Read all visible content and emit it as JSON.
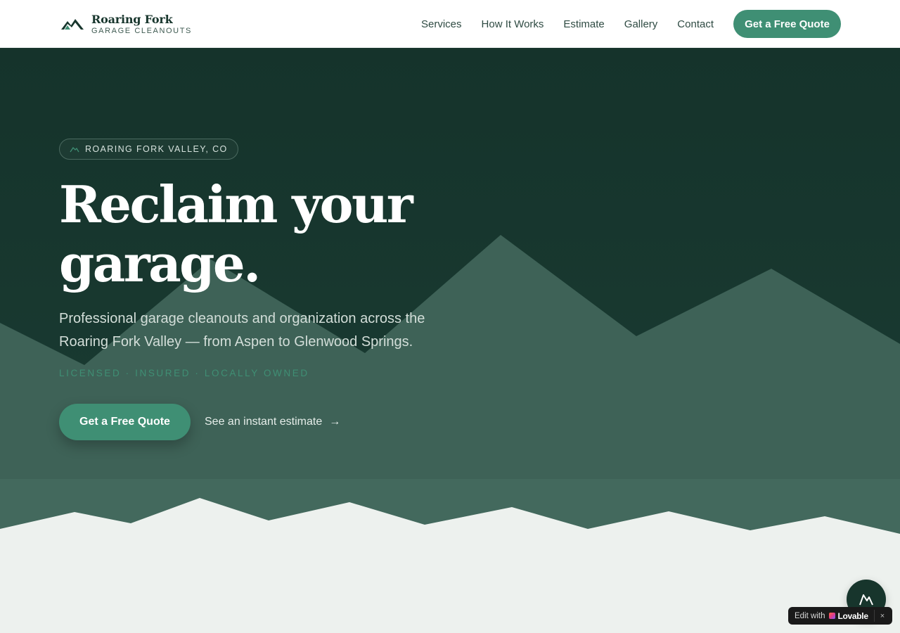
{
  "brand": {
    "name": "Roaring Fork",
    "subtitle": "GARAGE CLEANOUTS"
  },
  "nav": {
    "items": [
      "Services",
      "How It Works",
      "Estimate",
      "Gallery",
      "Contact"
    ],
    "cta": "Get a Free Quote"
  },
  "hero": {
    "badge": "ROARING FORK VALLEY, CO",
    "headline": "Reclaim your garage.",
    "subhead": "Professional garage cleanouts and organization across the Roaring Fork Valley — from Aspen to Glenwood Springs.",
    "trust": "LICENSED · INSURED · LOCALLY OWNED",
    "cta_primary": "Get a Free Quote",
    "cta_secondary": "See an instant estimate",
    "cta_secondary_arrow": "→"
  },
  "badge_widget": {
    "edit": "Edit with",
    "brand": "Lovable",
    "close": "×"
  },
  "colors": {
    "accent": "#3f8f74",
    "dark": "#17352c",
    "mountain": "#3e6257",
    "band": "#43695d",
    "light": "#edf1ee"
  },
  "icons": {
    "logo": "mountain-logo-icon",
    "badge": "mountain-icon",
    "fab": "mountain-icon",
    "arrow": "arrow-right-icon",
    "close": "close-icon"
  }
}
